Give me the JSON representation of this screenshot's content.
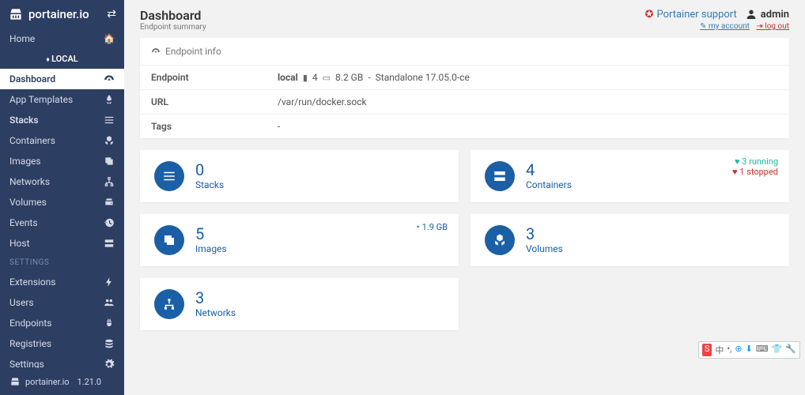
{
  "brand": "portainer.io",
  "version": "1.21.0",
  "page": {
    "title": "Dashboard",
    "subtitle": "Endpoint summary"
  },
  "header": {
    "support": "Portainer support",
    "user": "admin",
    "my_account": "my account",
    "log_out": "log out"
  },
  "sidebar": {
    "home": "Home",
    "local_label": "LOCAL",
    "items": [
      {
        "label": "Dashboard",
        "icon": "tachometer"
      },
      {
        "label": "App Templates",
        "icon": "rocket"
      },
      {
        "label": "Stacks",
        "icon": "list"
      },
      {
        "label": "Containers",
        "icon": "cubes"
      },
      {
        "label": "Images",
        "icon": "clone"
      },
      {
        "label": "Networks",
        "icon": "sitemap"
      },
      {
        "label": "Volumes",
        "icon": "hdd"
      },
      {
        "label": "Events",
        "icon": "history"
      },
      {
        "label": "Host",
        "icon": "server"
      }
    ],
    "settings_label": "SETTINGS",
    "settings": [
      {
        "label": "Extensions",
        "icon": "bolt"
      },
      {
        "label": "Users",
        "icon": "users"
      },
      {
        "label": "Endpoints",
        "icon": "plug"
      },
      {
        "label": "Registries",
        "icon": "database"
      },
      {
        "label": "Settings",
        "icon": "cogs"
      }
    ]
  },
  "endpoint_panel": {
    "title": "Endpoint info",
    "rows": {
      "Endpoint": {
        "name": "local",
        "cpus": "4",
        "mem": "8.2 GB",
        "engine": "Standalone 17.05.0-ce"
      },
      "URL": "/var/run/docker.sock",
      "Tags": "-"
    },
    "labels": {
      "endpoint": "Endpoint",
      "url": "URL",
      "tags": "Tags"
    }
  },
  "cards": {
    "stacks": {
      "count": "0",
      "label": "Stacks"
    },
    "containers": {
      "count": "4",
      "label": "Containers",
      "running": "3 running",
      "stopped": "1 stopped"
    },
    "images": {
      "count": "5",
      "label": "Images",
      "size": "1.9 GB"
    },
    "volumes": {
      "count": "3",
      "label": "Volumes"
    },
    "networks": {
      "count": "3",
      "label": "Networks"
    }
  }
}
